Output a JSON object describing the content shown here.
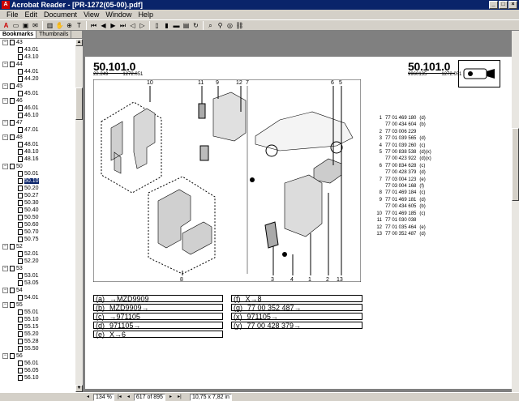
{
  "window": {
    "title": "Acrobat Reader - [PR-1272(05-00).pdf]",
    "icon": "acrobat-icon",
    "buttons": [
      "_",
      "□",
      "×"
    ]
  },
  "menu": [
    "File",
    "Edit",
    "Document",
    "View",
    "Window",
    "Help"
  ],
  "toolbar": {
    "icons": [
      "open-icon",
      "print-icon",
      "save-icon",
      "email-icon",
      "thumbnail-icon",
      "hand-icon",
      "zoom-icon",
      "select-text-icon",
      "first-page-icon",
      "prev-page-icon",
      "next-page-icon",
      "last-page-icon",
      "back-icon",
      "forward-icon",
      "actual-size-icon",
      "fit-page-icon",
      "fit-width-icon",
      "continuous-icon",
      "rotate-icon",
      "find-icon",
      "search-icon",
      "web-icon",
      "link-icon"
    ]
  },
  "panel": {
    "tabs": [
      "Bookmarks",
      "Thumbnails"
    ],
    "tree": [
      {
        "label": "43",
        "level": 0,
        "expanded": true
      },
      {
        "label": "43.01",
        "level": 1
      },
      {
        "label": "43.10",
        "level": 1
      },
      {
        "label": "44",
        "level": 0,
        "expanded": true
      },
      {
        "label": "44.01",
        "level": 1
      },
      {
        "label": "44.20",
        "level": 1
      },
      {
        "label": "45",
        "level": 0,
        "expanded": true
      },
      {
        "label": "45.01",
        "level": 1
      },
      {
        "label": "46",
        "level": 0,
        "expanded": true
      },
      {
        "label": "46.01",
        "level": 1
      },
      {
        "label": "46.10",
        "level": 1
      },
      {
        "label": "47",
        "level": 0,
        "expanded": true
      },
      {
        "label": "47.01",
        "level": 1
      },
      {
        "label": "48",
        "level": 0,
        "expanded": true
      },
      {
        "label": "48.01",
        "level": 1
      },
      {
        "label": "48.10",
        "level": 1
      },
      {
        "label": "48.16",
        "level": 1
      },
      {
        "label": "50",
        "level": 0,
        "expanded": true
      },
      {
        "label": "50.01",
        "level": 1
      },
      {
        "label": "50.10",
        "level": 1,
        "selected": true
      },
      {
        "label": "50.20",
        "level": 1
      },
      {
        "label": "50.27",
        "level": 1
      },
      {
        "label": "50.30",
        "level": 1
      },
      {
        "label": "50.40",
        "level": 1
      },
      {
        "label": "50.50",
        "level": 1
      },
      {
        "label": "50.60",
        "level": 1
      },
      {
        "label": "50.70",
        "level": 1
      },
      {
        "label": "50.75",
        "level": 1
      },
      {
        "label": "52",
        "level": 0,
        "expanded": true
      },
      {
        "label": "52.01",
        "level": 1
      },
      {
        "label": "52.20",
        "level": 1
      },
      {
        "label": "53",
        "level": 0,
        "expanded": true
      },
      {
        "label": "53.01",
        "level": 1
      },
      {
        "label": "53.05",
        "level": 1
      },
      {
        "label": "54",
        "level": 0,
        "expanded": true
      },
      {
        "label": "54.01",
        "level": 1
      },
      {
        "label": "55",
        "level": 0,
        "expanded": true
      },
      {
        "label": "55.01",
        "level": 1
      },
      {
        "label": "55.10",
        "level": 1
      },
      {
        "label": "55.15",
        "level": 1
      },
      {
        "label": "55.20",
        "level": 1
      },
      {
        "label": "55.28",
        "level": 1
      },
      {
        "label": "55.50",
        "level": 1
      },
      {
        "label": "56",
        "level": 0,
        "expanded": true
      },
      {
        "label": "56.01",
        "level": 1
      },
      {
        "label": "56.05",
        "level": 1
      },
      {
        "label": "56.10",
        "level": 1
      }
    ]
  },
  "page": {
    "left_code": "50.101.0",
    "left_sub": [
      "22.249",
      "1272.051"
    ],
    "right_code": "50.101.0",
    "right_sub": [
      "9960135",
      "1272.051"
    ],
    "callouts_top": [
      "10",
      "11",
      "9",
      "12",
      "7",
      "6",
      "5"
    ],
    "callouts_bottom": [
      "8",
      "3",
      "4",
      "1",
      "2",
      "13"
    ],
    "parts": [
      {
        "n": "1",
        "ref": "77 01 469 180",
        "code": "(d)"
      },
      {
        "n": "",
        "ref": "77 00 434 604",
        "code": "(b)"
      },
      {
        "n": "2",
        "ref": "77 03 006 229",
        "code": ""
      },
      {
        "n": "3",
        "ref": "77 01 039 565",
        "code": "(d)"
      },
      {
        "n": "4",
        "ref": "77 01 039 260",
        "code": "(c)"
      },
      {
        "n": "5",
        "ref": "77 00 838 538",
        "code": "(d)(x)"
      },
      {
        "n": "",
        "ref": "77 00 423 922",
        "code": "(d)(x)"
      },
      {
        "n": "6",
        "ref": "77 00 834 628",
        "code": "(c)"
      },
      {
        "n": "",
        "ref": "77 00 428 379",
        "code": "(d)"
      },
      {
        "n": "7",
        "ref": "77 03 004 123",
        "code": "(e)"
      },
      {
        "n": "",
        "ref": "77 03 004 168",
        "code": "(f)"
      },
      {
        "n": "8",
        "ref": "77 01 469 184",
        "code": "(c)"
      },
      {
        "n": "9",
        "ref": "77 01 469 181",
        "code": "(d)"
      },
      {
        "n": "",
        "ref": "77 00 434 605",
        "code": "(b)"
      },
      {
        "n": "10",
        "ref": "77 01 469 185",
        "code": "(c)"
      },
      {
        "n": "11",
        "ref": "77 01 030 038",
        "code": ""
      },
      {
        "n": "12",
        "ref": "77 01 035 464",
        "code": "(e)"
      },
      {
        "n": "13",
        "ref": "77 00 352 487",
        "code": "(d)"
      }
    ],
    "legend_left": [
      {
        "key": "(a)",
        "text": "→MZD9909"
      },
      {
        "key": "(b)",
        "text": "MZD9909→"
      },
      {
        "key": "(c)",
        "text": "→971105"
      },
      {
        "key": "(d)",
        "text": "971105→"
      },
      {
        "key": "(e)",
        "text": "X→6"
      }
    ],
    "legend_right": [
      {
        "key": "(f)",
        "text": "X→8"
      },
      {
        "key": "(g)",
        "text": "77 00 352 487→"
      },
      {
        "key": "(x)",
        "text": "971105→"
      },
      {
        "key": "(y)",
        "text": "77 00 428 379→"
      }
    ]
  },
  "status": {
    "zoom": "134 %",
    "page": "617 of 895",
    "size": "10,75 x 7,82 in"
  }
}
